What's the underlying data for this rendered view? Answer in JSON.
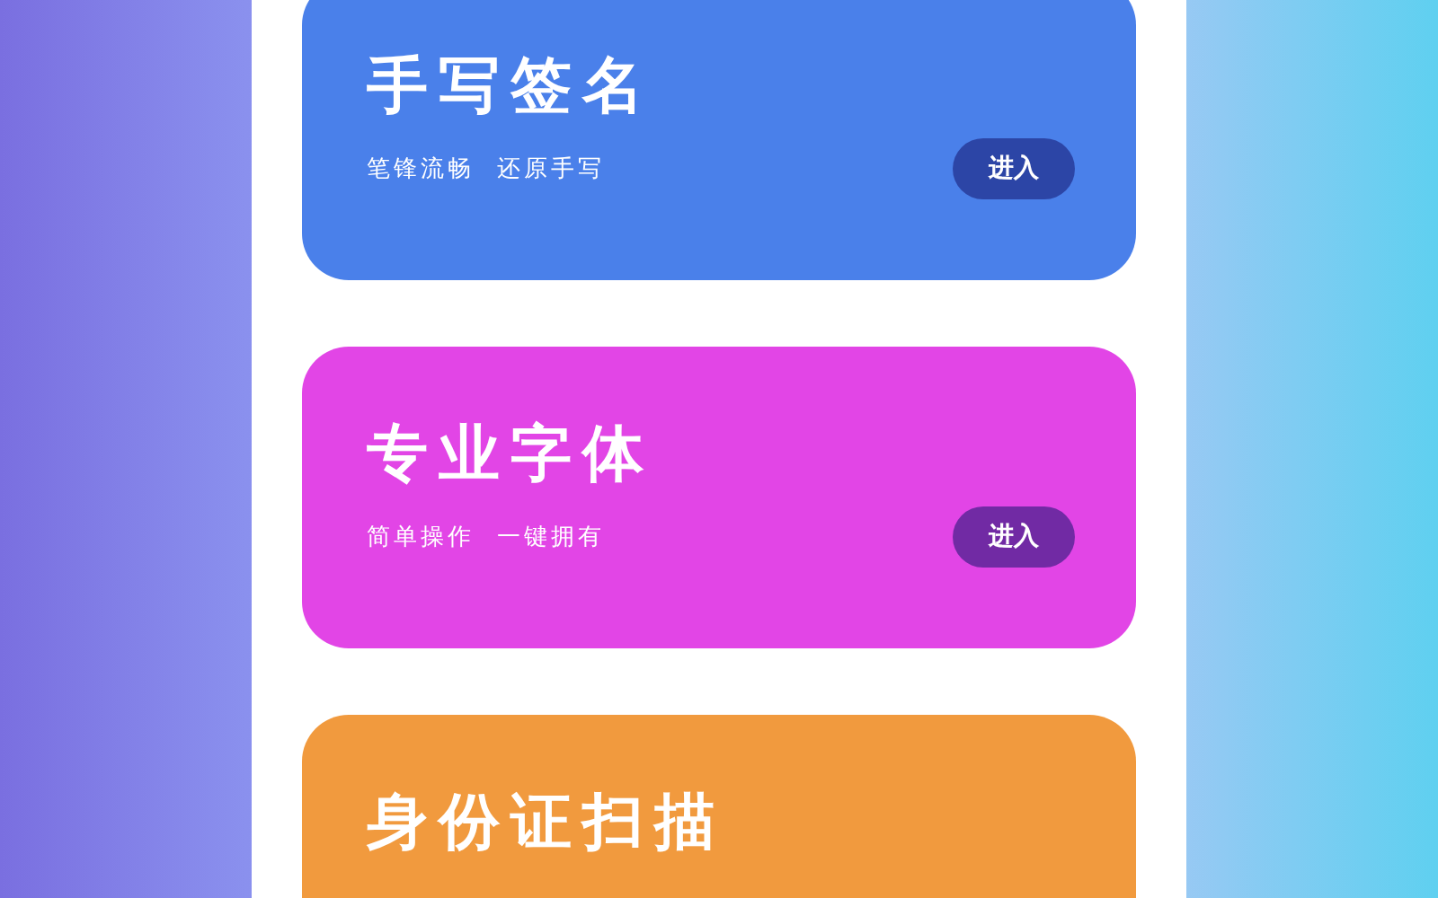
{
  "cards": [
    {
      "title": "手写签名",
      "subtitle": "笔锋流畅  还原手写",
      "button": "进入",
      "color": "#4a80ea"
    },
    {
      "title": "专业字体",
      "subtitle": "简单操作  一键拥有",
      "button": "进入",
      "color": "#e245e6"
    },
    {
      "title": "身份证扫描",
      "color": "#f19a3e"
    }
  ]
}
